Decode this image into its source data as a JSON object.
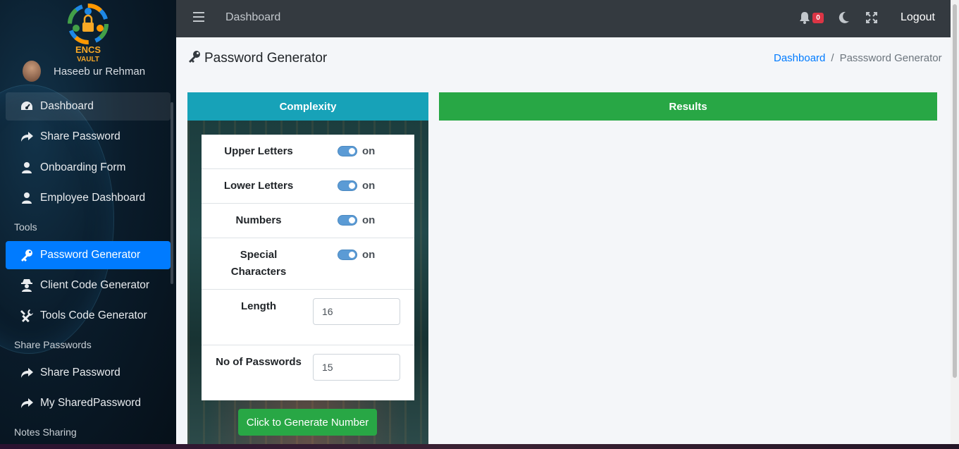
{
  "app": {
    "logo_text_top": "ENCS",
    "logo_text_bottom": "VAULT"
  },
  "user": {
    "name": "Haseeb ur Rehman"
  },
  "sidebar": {
    "items": [
      {
        "label": "Dashboard",
        "icon": "tachometer-icon"
      },
      {
        "label": "Share Password",
        "icon": "share-arrow-icon"
      },
      {
        "label": "Onboarding Form",
        "icon": "user-icon"
      },
      {
        "label": "Employee Dashboard",
        "icon": "user-icon"
      }
    ],
    "headers": {
      "tools": "Tools",
      "share_passwords": "Share Passwords",
      "notes_sharing": "Notes Sharing"
    },
    "tools_items": [
      {
        "label": "Password Generator",
        "icon": "key-icon",
        "active": true
      },
      {
        "label": "Client Code Generator",
        "icon": "user-secret-icon"
      },
      {
        "label": "Tools Code Generator",
        "icon": "tools-icon"
      }
    ],
    "share_items": [
      {
        "label": "Share Password",
        "icon": "share-arrow-icon"
      },
      {
        "label": "My SharedPassword",
        "icon": "share-arrow-icon"
      }
    ]
  },
  "topbar": {
    "title": "Dashboard",
    "notification_count": "0",
    "logout_label": "Logout"
  },
  "page": {
    "title": "Password Generator",
    "breadcrumb": {
      "home": "Dashboard",
      "separator": "/",
      "current": "Passsword Generator"
    }
  },
  "complexity": {
    "header": "Complexity",
    "options": [
      {
        "label": "Upper Letters",
        "state": "on"
      },
      {
        "label": "Lower Letters",
        "state": "on"
      },
      {
        "label": "Numbers",
        "state": "on"
      },
      {
        "label_line1": "Special",
        "label_line2": "Characters",
        "state": "on"
      }
    ],
    "length": {
      "label": "Length",
      "value": "16"
    },
    "count": {
      "label": "No of Passwords",
      "value": "15"
    },
    "generate_label": "Click to Generate Number"
  },
  "results": {
    "header": "Results"
  },
  "colors": {
    "active_nav": "#007bff",
    "complexity_header": "#17a2b8",
    "results_header": "#28a745",
    "badge": "#dc3545"
  }
}
